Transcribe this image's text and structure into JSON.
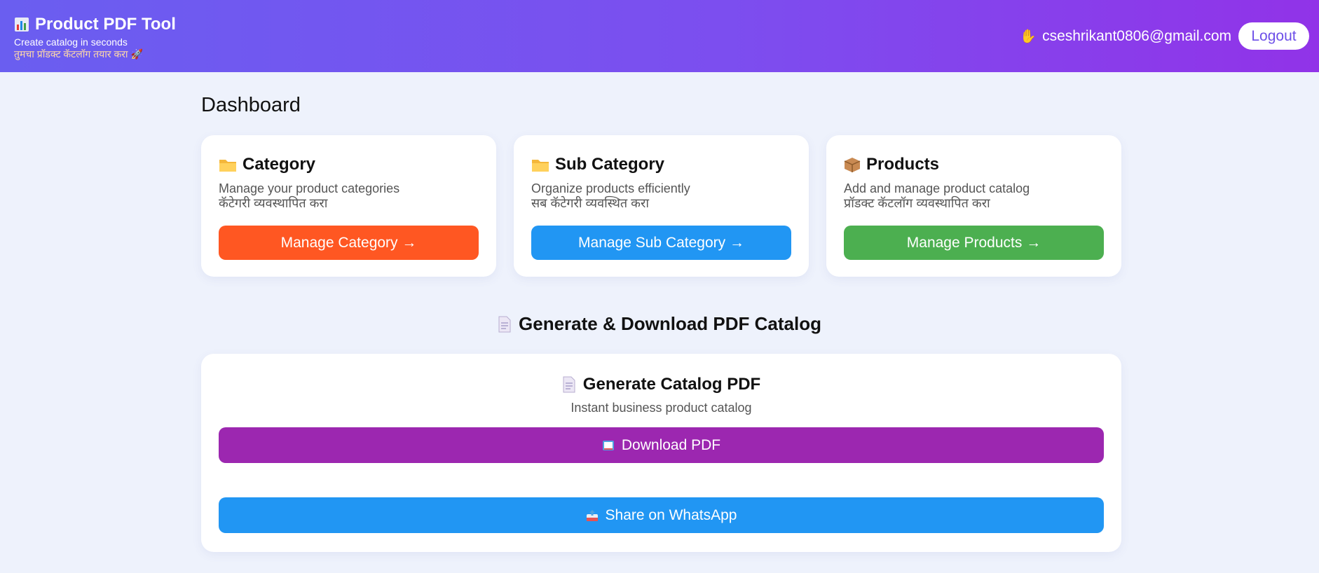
{
  "header": {
    "brand_title": "Product PDF Tool",
    "brand_icon": "bar-chart-icon",
    "tagline": "Create catalog in seconds",
    "tagline_mr": "तुमचा प्रॉडक्ट कॅटलॉग तयार करा 🚀",
    "user_email": "cseshrikant0806@gmail.com",
    "user_icon": "waving-hand-icon",
    "logout_label": "Logout"
  },
  "page_title": "Dashboard",
  "cards": [
    {
      "icon": "folder-icon",
      "title": "Category",
      "desc": "Manage your product categories",
      "desc_mr": "कॅटेगरी व्यवस्थापित करा",
      "button": "Manage Category →",
      "color": "#ff5722"
    },
    {
      "icon": "folder-icon",
      "title": "Sub Category",
      "desc": "Organize products efficiently",
      "desc_mr": "सब कॅटेगरी व्यवस्थित करा",
      "button": "Manage Sub Category →",
      "color": "#2196f3"
    },
    {
      "icon": "package-icon",
      "title": "Products",
      "desc": "Add and manage product catalog",
      "desc_mr": "प्रॉडक्ट कॅटलॉग व्यवस्थापित करा",
      "button": "Manage Products →",
      "color": "#4caf50"
    }
  ],
  "pdf_section": {
    "title": "Generate & Download PDF Catalog",
    "title_icon": "document-icon",
    "card_title": "Generate Catalog PDF",
    "card_icon": "document-icon",
    "card_sub": "Instant business product catalog",
    "download_label": "Download PDF",
    "download_icon": "book-icon",
    "download_color": "#9c27b0",
    "share_label": "Share on WhatsApp",
    "share_icon": "outbox-icon",
    "share_color": "#2196f3"
  },
  "colors": {
    "header_gradient_start": "#6a5ef0",
    "header_gradient_end": "#9133e8",
    "background": "#eef2fc"
  }
}
